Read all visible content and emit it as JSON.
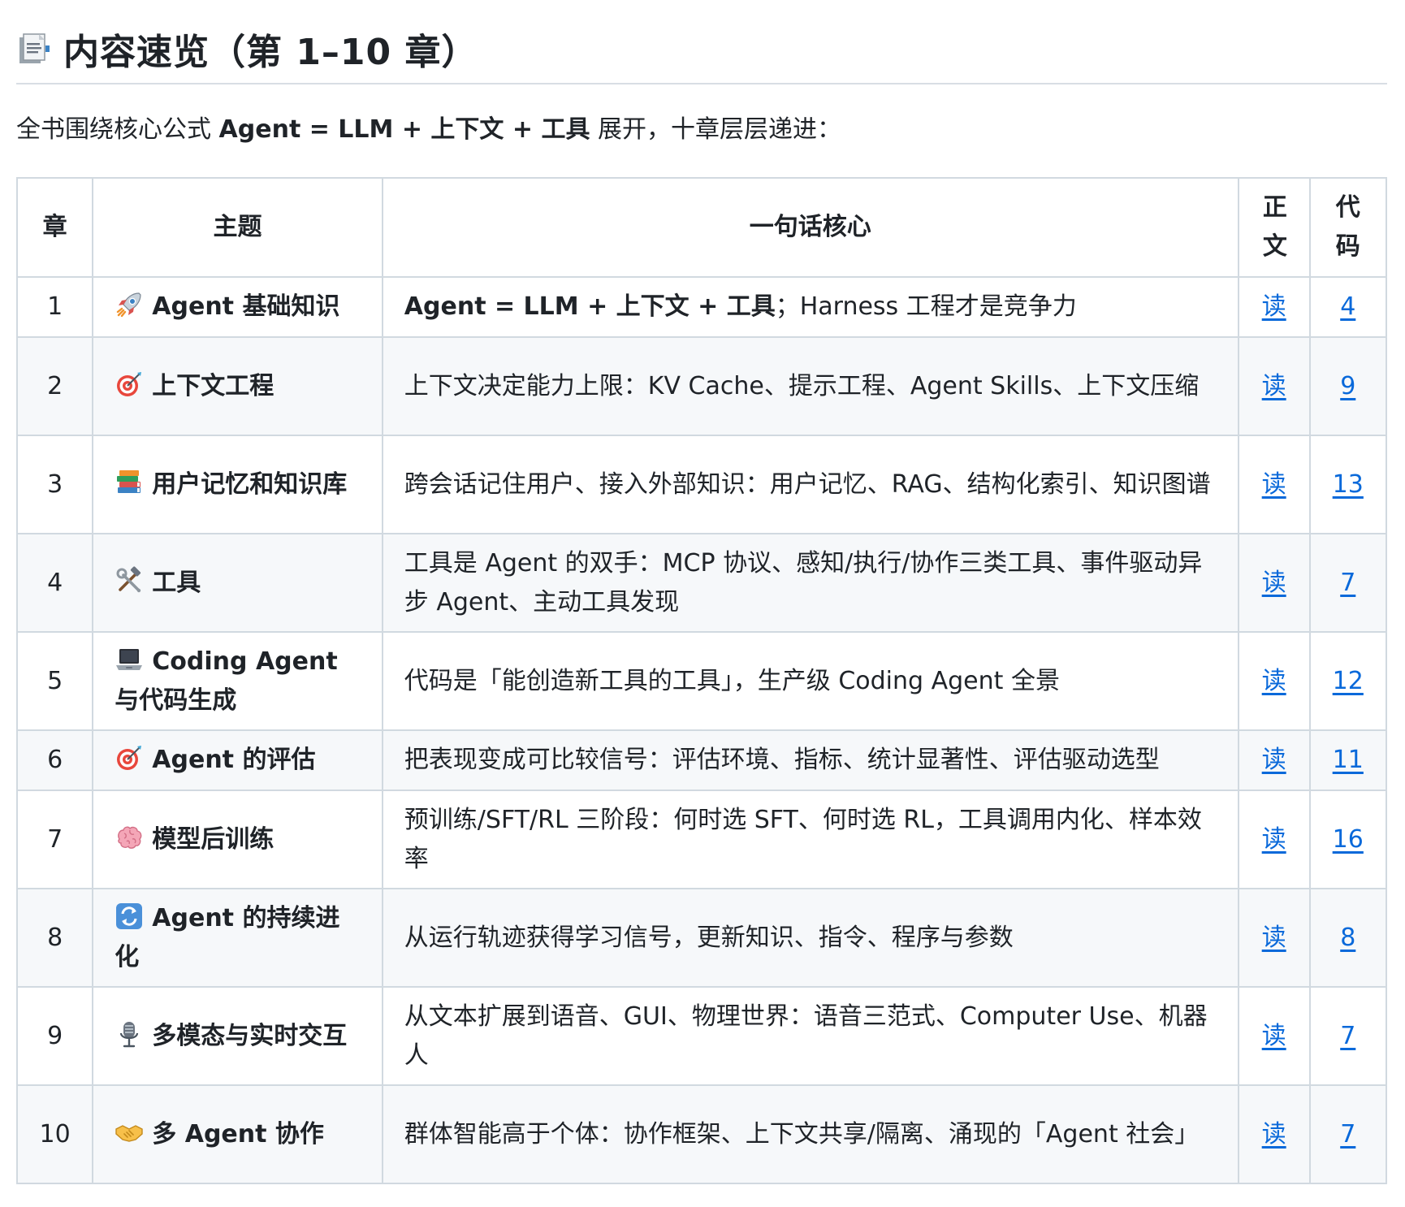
{
  "heading": {
    "title": "内容速览（第 1–10 章）",
    "icon": "page-facing-up-icon"
  },
  "intro": {
    "prefix": "全书围绕核心公式 ",
    "formula": "Agent = LLM + 上下文 + 工具",
    "suffix": " 展开，十章层层递进："
  },
  "table": {
    "headers": {
      "chapter": "章",
      "topic": "主题",
      "core": "一句话核心",
      "text": "正文",
      "code": "代码"
    },
    "rows": [
      {
        "num": "1",
        "icon": "rocket-icon",
        "topic": "Agent 基础知识",
        "core_bold": "Agent = LLM + 上下文 + 工具",
        "core": "；Harness 工程才是竞争力",
        "read": "读",
        "code": "4"
      },
      {
        "num": "2",
        "icon": "direct-hit-icon",
        "topic": "上下文工程",
        "core_bold": "",
        "core": "上下文决定能力上限：KV Cache、提示工程、Agent Skills、上下文压缩",
        "read": "读",
        "code": "9"
      },
      {
        "num": "3",
        "icon": "books-icon",
        "topic": "用户记忆和知识库",
        "core_bold": "",
        "core": "跨会话记住用户、接入外部知识：用户记忆、RAG、结构化索引、知识图谱",
        "read": "读",
        "code": "13"
      },
      {
        "num": "4",
        "icon": "hammer-and-wrench-icon",
        "topic": "工具",
        "core_bold": "",
        "core": "工具是 Agent 的双手：MCP 协议、感知/执行/协作三类工具、事件驱动异步 Agent、主动工具发现",
        "read": "读",
        "code": "7"
      },
      {
        "num": "5",
        "icon": "laptop-icon",
        "topic": "Coding Agent 与代码生成",
        "core_bold": "",
        "core": "代码是「能创造新工具的工具」，生产级 Coding Agent 全景",
        "read": "读",
        "code": "12"
      },
      {
        "num": "6",
        "icon": "direct-hit-icon",
        "topic": "Agent 的评估",
        "core_bold": "",
        "core": "把表现变成可比较信号：评估环境、指标、统计显著性、评估驱动选型",
        "read": "读",
        "code": "11"
      },
      {
        "num": "7",
        "icon": "brain-icon",
        "topic": "模型后训练",
        "core_bold": "",
        "core": "预训练/SFT/RL 三阶段：何时选 SFT、何时选 RL，工具调用内化、样本效率",
        "read": "读",
        "code": "16"
      },
      {
        "num": "8",
        "icon": "arrows-cycle-icon",
        "topic": "Agent 的持续进化",
        "core_bold": "",
        "core": "从运行轨迹获得学习信号，更新知识、指令、程序与参数",
        "read": "读",
        "code": "8"
      },
      {
        "num": "9",
        "icon": "microphone-icon",
        "topic": "多模态与实时交互",
        "core_bold": "",
        "core": "从文本扩展到语音、GUI、物理世界：语音三范式、Computer Use、机器人",
        "read": "读",
        "code": "7"
      },
      {
        "num": "10",
        "icon": "handshake-icon",
        "topic": "多 Agent 协作",
        "core_bold": "",
        "core": "群体智能高于个体：协作框架、上下文共享/隔离、涌现的「Agent 社会」",
        "read": "读",
        "code": "7"
      }
    ]
  }
}
